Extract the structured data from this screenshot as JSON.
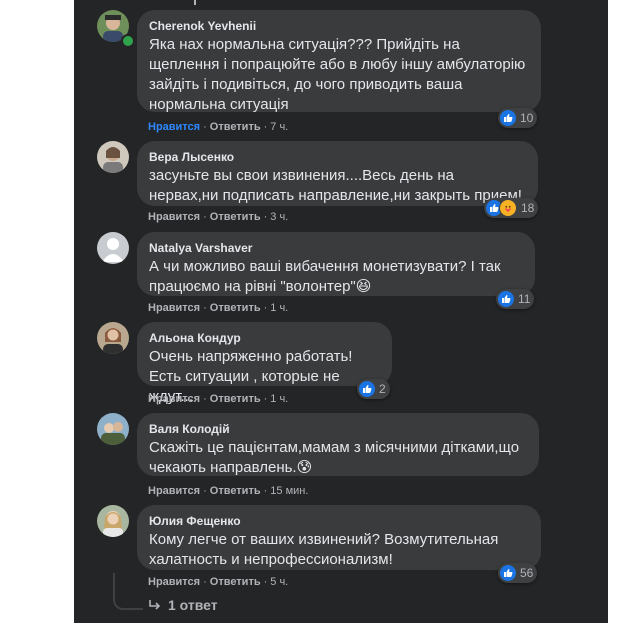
{
  "labels": {
    "like": "Нравится",
    "reply": "Ответить"
  },
  "comments": [
    {
      "author": "Cherenok Yevhenii",
      "text": "Яка нах нормальна ситуація??? Прийдіть на щеплення і попрацюйте або в любу іншу амбулаторію зайдіть і подивіться, до чого приводить ваша нормальна ситуація",
      "time": "7 ч.",
      "liked": true,
      "reactions": [
        "like"
      ],
      "reaction_count": "10",
      "online": true
    },
    {
      "author": "Вера Лысенко",
      "text": "засуньте вы свои извинения....Весь день на нервах,ни подписать направление,ни закрыть прием!",
      "time": "3 ч.",
      "liked": false,
      "reactions": [
        "like",
        "care"
      ],
      "reaction_count": "18",
      "online": false
    },
    {
      "author": "Natalya Varshaver",
      "text": "А чи можливо ваші вибачення монетизувати? І так працюємо на рівні \"волонтер\"😆",
      "time": "1 ч.",
      "liked": false,
      "reactions": [
        "like"
      ],
      "reaction_count": "11",
      "online": false
    },
    {
      "author": "Альона Кондур",
      "text": "Очень напряженно работать! Есть ситуации , которые не ждут...",
      "time": "1 ч.",
      "liked": false,
      "reactions": [
        "like"
      ],
      "reaction_count": "2",
      "online": false
    },
    {
      "author": "Валя Колодій",
      "text": "Скажіть це пацієнтам,мамам з місячними дітками,що чекають направлень.😰",
      "time": "15 мин.",
      "liked": false,
      "reactions": [],
      "reaction_count": "",
      "online": false
    },
    {
      "author": "Юлия Фещенко",
      "text": "Кому легче от ваших извинений? Возмутительная халатность и непрофессионализм!",
      "time": "5 ч.",
      "liked": false,
      "reactions": [
        "like"
      ],
      "reaction_count": "56",
      "online": false
    }
  ],
  "replies_link": "1 ответ",
  "colors": {
    "background": "#242526",
    "bubble": "#3a3b3c",
    "text": "#e4e6eb",
    "muted": "#b0b3b8",
    "like_active": "#2d88ff",
    "like_reaction": "#1b74e4",
    "online": "#31a24c"
  },
  "icons": [
    "avatar-photo",
    "like-reaction-icon",
    "care-reaction-icon",
    "reply-arrow-icon"
  ]
}
